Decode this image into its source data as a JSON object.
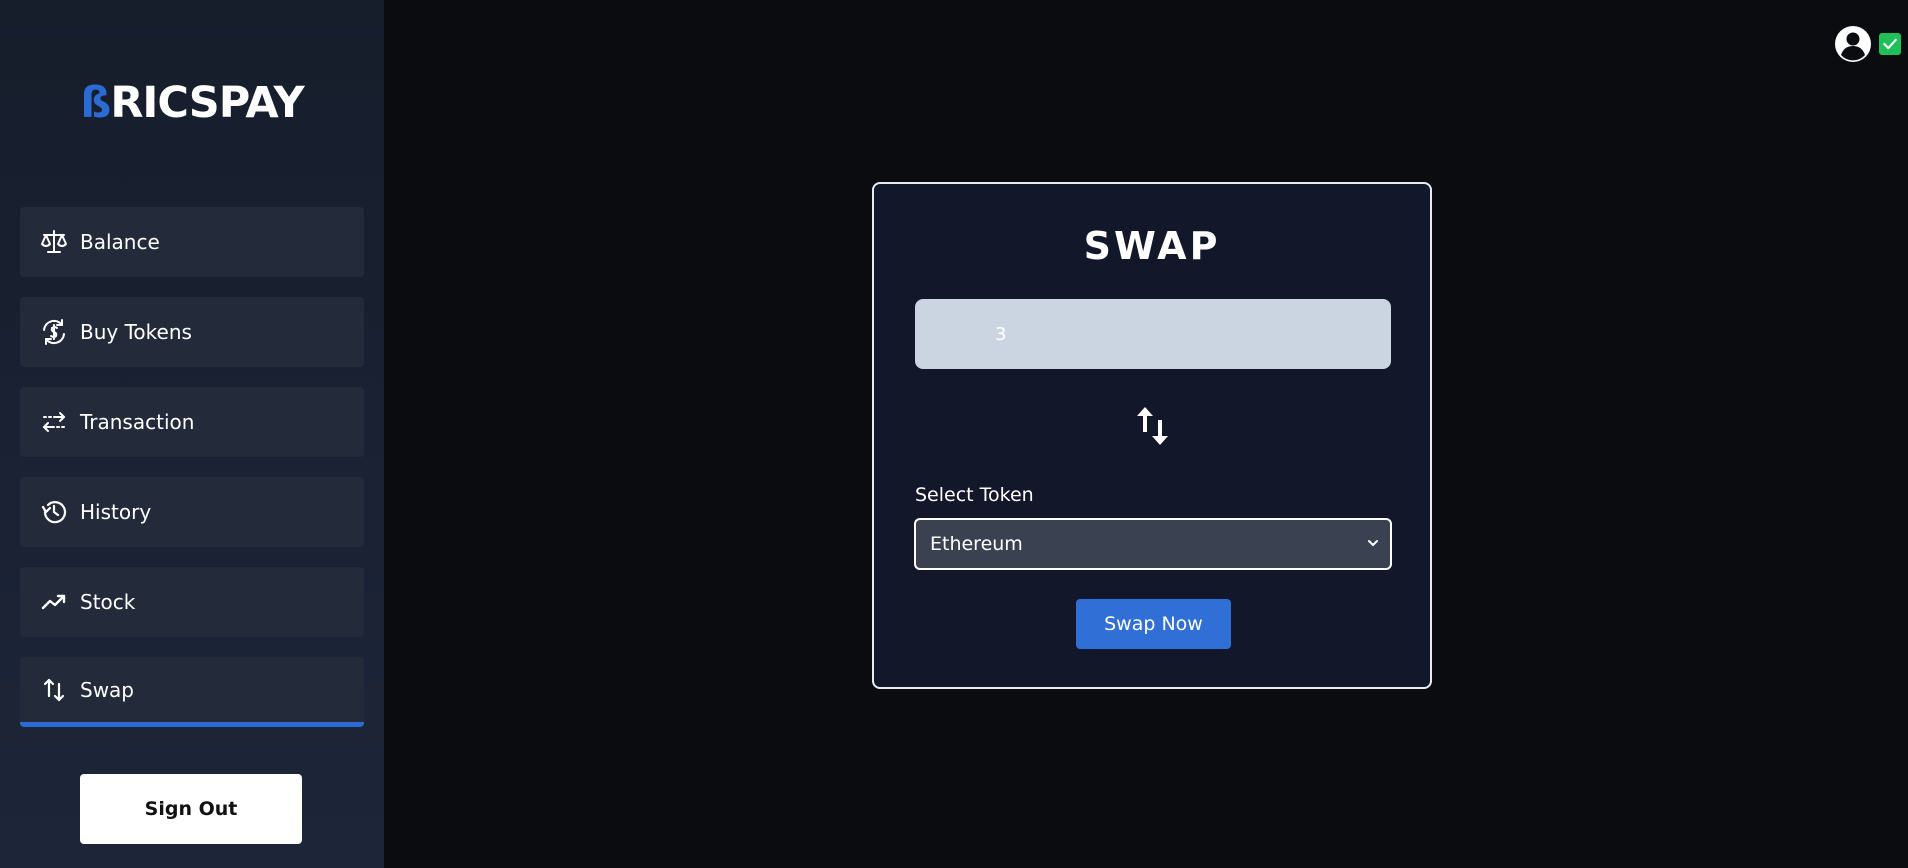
{
  "brand": {
    "logo_mark": "ß",
    "logo_text": "RICSPAY",
    "accent_color": "#2d6bd4"
  },
  "sidebar": {
    "items": [
      {
        "label": "Balance",
        "icon": "scale-icon",
        "active": false
      },
      {
        "label": "Buy Tokens",
        "icon": "dollar-cycle-icon",
        "active": false
      },
      {
        "label": "Transaction",
        "icon": "transfer-arrows-icon",
        "active": false
      },
      {
        "label": "History",
        "icon": "history-icon",
        "active": false
      },
      {
        "label": "Stock",
        "icon": "trending-up-icon",
        "active": false
      },
      {
        "label": "Swap",
        "icon": "swap-arrows-icon",
        "active": true
      }
    ],
    "signout_label": "Sign Out"
  },
  "header": {
    "avatar_icon": "user-circle-icon",
    "status_icon": "check-badge-icon",
    "status_color": "#1fc05a"
  },
  "swap": {
    "title": "SWAP",
    "amount_value": "3",
    "swap_icon": "swap-arrows-icon",
    "select_label": "Select Token",
    "selected_token": "Ethereum",
    "button_label": "Swap Now"
  }
}
